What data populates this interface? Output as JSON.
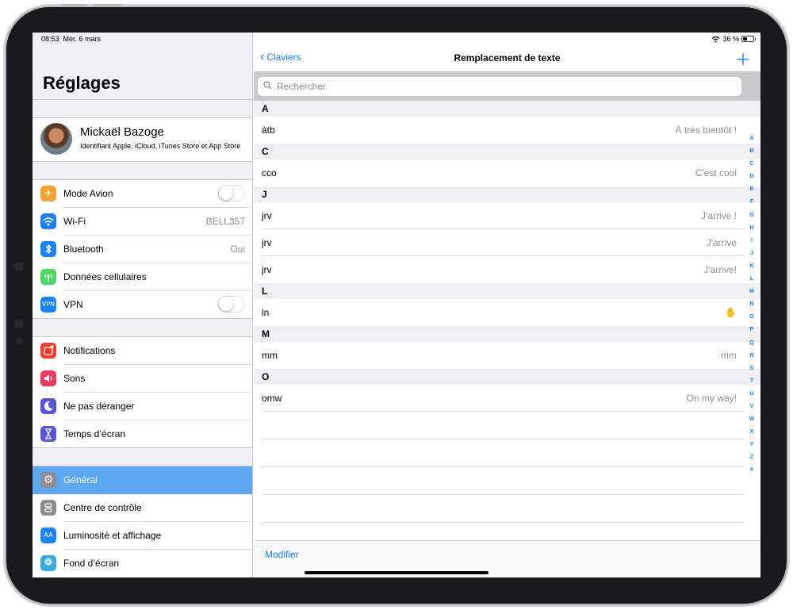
{
  "status": {
    "time": "08:53",
    "date": "Mer. 6 mars",
    "battery": "36 %"
  },
  "sidebar": {
    "title": "Réglages",
    "profile": {
      "name": "Mickaël Bazoge",
      "subtitle": "Identifiant Apple, iCloud, iTunes Store et App Store"
    },
    "group1": [
      {
        "label": "Mode Avion",
        "icon": "airplane-icon",
        "color": "#f7a234",
        "toggle": false
      },
      {
        "label": "Wi-Fi",
        "icon": "wifi-icon",
        "color": "#1a82fb",
        "value": "BELL357"
      },
      {
        "label": "Bluetooth",
        "icon": "bluetooth-icon",
        "color": "#1a82fb",
        "value": "Oui"
      },
      {
        "label": "Données cellulaires",
        "icon": "cellular-icon",
        "color": "#4cd964"
      },
      {
        "label": "VPN",
        "icon": "vpn-icon",
        "color": "#1a82fb",
        "toggle": false,
        "badge": "VPN"
      }
    ],
    "group2": [
      {
        "label": "Notifications",
        "icon": "notifications-icon",
        "color": "#f33b30"
      },
      {
        "label": "Sons",
        "icon": "sounds-icon",
        "color": "#f2355b"
      },
      {
        "label": "Ne pas déranger",
        "icon": "moon-icon",
        "color": "#5856d6"
      },
      {
        "label": "Temps d’écran",
        "icon": "hourglass-icon",
        "color": "#5856d6"
      }
    ],
    "group3": [
      {
        "label": "Général",
        "icon": "gear-icon",
        "color": "#8e8e93",
        "selected": true
      },
      {
        "label": "Centre de contrôle",
        "icon": "control-center-icon",
        "color": "#8e8e93"
      },
      {
        "label": "Luminosité et affichage",
        "icon": "display-icon",
        "color": "#1a82fb",
        "badge": "AA"
      },
      {
        "label": "Fond d’écran",
        "icon": "wallpaper-icon",
        "color": "#35aadc"
      }
    ]
  },
  "detail": {
    "back_label": "Claviers",
    "title": "Remplacement de texte",
    "search_placeholder": "Rechercher",
    "sections": [
      {
        "header": "A",
        "items": [
          {
            "shortcut": "àtb",
            "phrase": "À très bientôt !"
          }
        ]
      },
      {
        "header": "C",
        "items": [
          {
            "shortcut": "cco",
            "phrase": "C'est cool"
          }
        ]
      },
      {
        "header": "J",
        "items": [
          {
            "shortcut": "jrv",
            "phrase": "J'arrive !"
          },
          {
            "shortcut": "jrv",
            "phrase": "J'arrive"
          },
          {
            "shortcut": "jrv",
            "phrase": "J'arrive!"
          }
        ]
      },
      {
        "header": "L",
        "items": [
          {
            "shortcut": "ln",
            "phrase": "✋"
          }
        ]
      },
      {
        "header": "M",
        "items": [
          {
            "shortcut": "mm",
            "phrase": "mm"
          }
        ]
      },
      {
        "header": "O",
        "items": [
          {
            "shortcut": "omw",
            "phrase": "On my way!"
          }
        ]
      }
    ],
    "index_letters": [
      "A",
      "B",
      "C",
      "D",
      "E",
      "F",
      "G",
      "H",
      "I",
      "J",
      "K",
      "L",
      "M",
      "N",
      "O",
      "P",
      "Q",
      "R",
      "S",
      "T",
      "U",
      "V",
      "W",
      "X",
      "Y",
      "Z",
      "#"
    ],
    "edit_label": "Modifier"
  }
}
